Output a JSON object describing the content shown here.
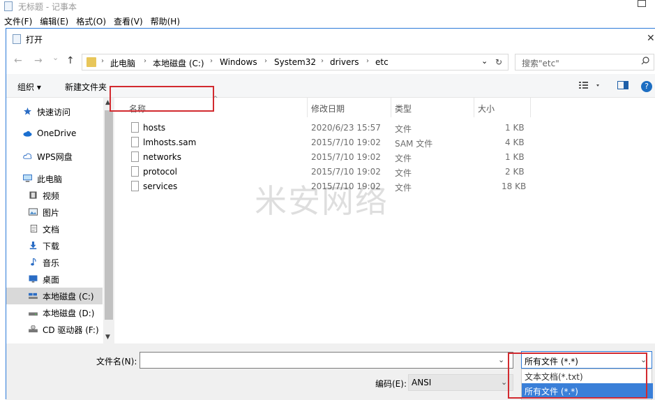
{
  "notepad": {
    "title": "无标题 - 记事本",
    "menu": [
      "文件(F)",
      "编辑(E)",
      "格式(O)",
      "查看(V)",
      "帮助(H)"
    ]
  },
  "dialog": {
    "title": "打开",
    "close_glyph": "✕"
  },
  "nav": {
    "back_glyph": "←",
    "forward_glyph": "→",
    "recent_glyph": "⌄",
    "up_glyph": "↑",
    "breadcrumbs": [
      "此电脑",
      "本地磁盘 (C:)",
      "Windows",
      "System32",
      "drivers",
      "etc"
    ],
    "dropdown_glyph": "⌄",
    "refresh_glyph": "↻",
    "search_placeholder": "搜索\"etc\""
  },
  "toolbar": {
    "organize": "组织 ▾",
    "new_folder": "新建文件夹",
    "help_glyph": "?"
  },
  "sidebar": {
    "items": [
      {
        "label": "快速访问",
        "icon": "star-icon"
      },
      {
        "label": "OneDrive",
        "icon": "cloud-icon"
      },
      {
        "label": "WPS网盘",
        "icon": "cloud-outline-icon"
      },
      {
        "label": "此电脑",
        "icon": "computer-icon"
      },
      {
        "label": "视频",
        "icon": "video-icon"
      },
      {
        "label": "图片",
        "icon": "picture-icon"
      },
      {
        "label": "文档",
        "icon": "document-icon"
      },
      {
        "label": "下载",
        "icon": "download-icon"
      },
      {
        "label": "音乐",
        "icon": "music-icon"
      },
      {
        "label": "桌面",
        "icon": "desktop-icon"
      },
      {
        "label": "本地磁盘 (C:)",
        "icon": "drive-icon"
      },
      {
        "label": "本地磁盘 (D:)",
        "icon": "drive-icon"
      },
      {
        "label": "CD 驱动器 (F:)",
        "icon": "cd-drive-icon"
      }
    ],
    "selected_index": 10
  },
  "files": {
    "columns": [
      "名称",
      "修改日期",
      "类型",
      "大小"
    ],
    "rows": [
      {
        "name": "hosts",
        "date": "2020/6/23 15:57",
        "type": "文件",
        "size": "1 KB"
      },
      {
        "name": "lmhosts.sam",
        "date": "2015/7/10 19:02",
        "type": "SAM 文件",
        "size": "4 KB"
      },
      {
        "name": "networks",
        "date": "2015/7/10 19:02",
        "type": "文件",
        "size": "1 KB"
      },
      {
        "name": "protocol",
        "date": "2015/7/10 19:02",
        "type": "文件",
        "size": "2 KB"
      },
      {
        "name": "services",
        "date": "2015/7/10 19:02",
        "type": "文件",
        "size": "18 KB"
      }
    ]
  },
  "watermark": "米安网络",
  "bottom": {
    "filename_label": "文件名(N):",
    "filename_value": "",
    "filetype_value": "所有文件 (*.*)",
    "filetype_options": [
      "文本文档(*.txt)",
      "所有文件 (*.*)"
    ],
    "encoding_label": "编码(E):",
    "encoding_value": "ANSI"
  },
  "colors": {
    "accent": "#2b79d8",
    "highlight_red": "#d22a2f",
    "selection_blue": "#3a7fd8"
  }
}
